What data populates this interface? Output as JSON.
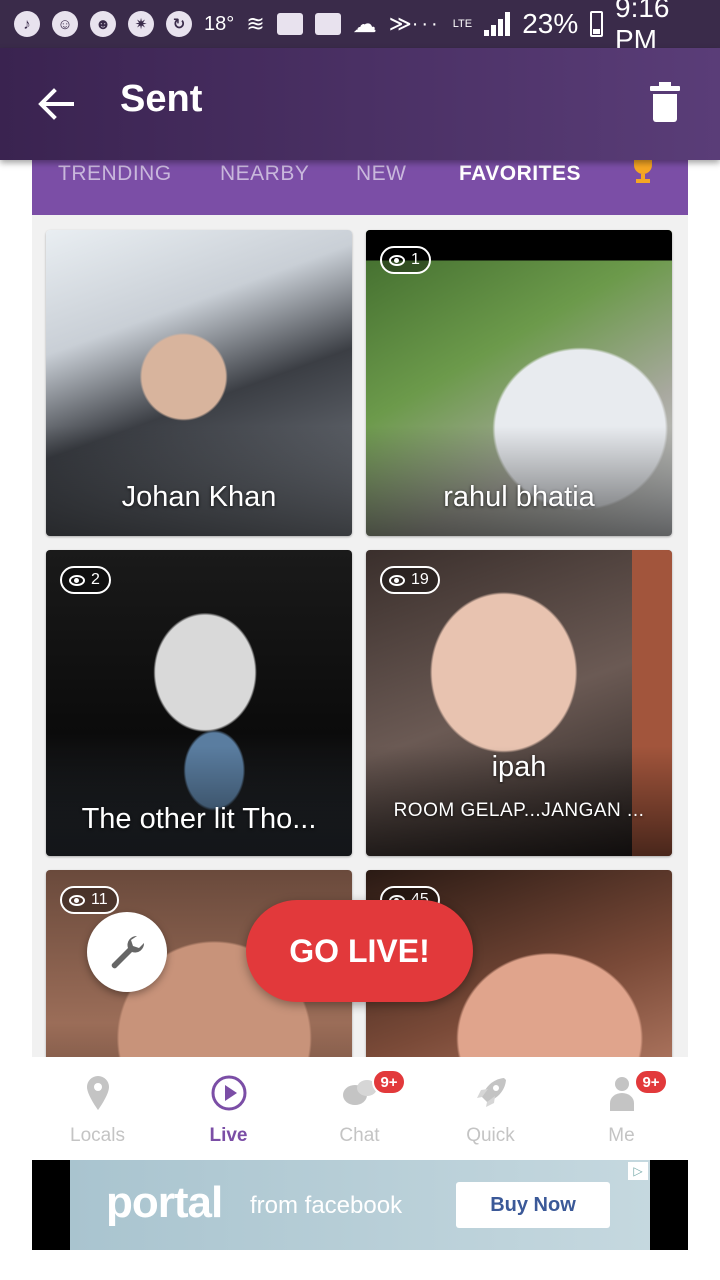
{
  "status_bar": {
    "temperature": "18°",
    "dots": "···",
    "network": "LTE",
    "battery": "23%",
    "time": "9:16 PM"
  },
  "app_bar": {
    "title": "Sent"
  },
  "tabs": [
    {
      "label": "TRENDING"
    },
    {
      "label": "NEARBY"
    },
    {
      "label": "NEW"
    },
    {
      "label": "FAVORITES",
      "active": true
    }
  ],
  "tiles": [
    {
      "name": "Johan Khan",
      "views": null
    },
    {
      "name": "rahul bhatia",
      "views": "1"
    },
    {
      "name": "The other lit Tho...",
      "views": "2"
    },
    {
      "name": "ipah",
      "subtitle": "ROOM GELAP...JANGAN ...",
      "views": "19"
    },
    {
      "name": "",
      "views": "11"
    },
    {
      "name": "",
      "views": "45"
    }
  ],
  "go_live_label": "GO LIVE!",
  "bottom_nav": [
    {
      "label": "Locals",
      "icon": "location-pin-icon"
    },
    {
      "label": "Live",
      "icon": "play-circle-icon",
      "active": true
    },
    {
      "label": "Chat",
      "icon": "chat-bubbles-icon",
      "badge": "9+"
    },
    {
      "label": "Quick",
      "icon": "rocket-icon"
    },
    {
      "label": "Me",
      "icon": "person-icon",
      "badge": "9+"
    }
  ],
  "ad": {
    "brand": "portal",
    "from": "from facebook",
    "button": "Buy Now"
  },
  "colors": {
    "accent_purple": "#7b4ea6",
    "app_bar": "#4a2f65",
    "go_live_red": "#e2393b",
    "trophy_gold": "#f5a623"
  }
}
